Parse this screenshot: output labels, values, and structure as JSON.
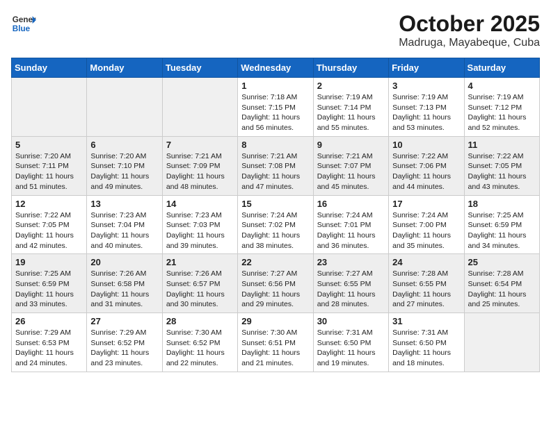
{
  "header": {
    "logo_general": "General",
    "logo_blue": "Blue",
    "month": "October 2025",
    "location": "Madruga, Mayabeque, Cuba"
  },
  "weekdays": [
    "Sunday",
    "Monday",
    "Tuesday",
    "Wednesday",
    "Thursday",
    "Friday",
    "Saturday"
  ],
  "weeks": [
    [
      {
        "day": "",
        "sunrise": "",
        "sunset": "",
        "daylight": ""
      },
      {
        "day": "",
        "sunrise": "",
        "sunset": "",
        "daylight": ""
      },
      {
        "day": "",
        "sunrise": "",
        "sunset": "",
        "daylight": ""
      },
      {
        "day": "1",
        "sunrise": "Sunrise: 7:18 AM",
        "sunset": "Sunset: 7:15 PM",
        "daylight": "Daylight: 11 hours and 56 minutes."
      },
      {
        "day": "2",
        "sunrise": "Sunrise: 7:19 AM",
        "sunset": "Sunset: 7:14 PM",
        "daylight": "Daylight: 11 hours and 55 minutes."
      },
      {
        "day": "3",
        "sunrise": "Sunrise: 7:19 AM",
        "sunset": "Sunset: 7:13 PM",
        "daylight": "Daylight: 11 hours and 53 minutes."
      },
      {
        "day": "4",
        "sunrise": "Sunrise: 7:19 AM",
        "sunset": "Sunset: 7:12 PM",
        "daylight": "Daylight: 11 hours and 52 minutes."
      }
    ],
    [
      {
        "day": "5",
        "sunrise": "Sunrise: 7:20 AM",
        "sunset": "Sunset: 7:11 PM",
        "daylight": "Daylight: 11 hours and 51 minutes."
      },
      {
        "day": "6",
        "sunrise": "Sunrise: 7:20 AM",
        "sunset": "Sunset: 7:10 PM",
        "daylight": "Daylight: 11 hours and 49 minutes."
      },
      {
        "day": "7",
        "sunrise": "Sunrise: 7:21 AM",
        "sunset": "Sunset: 7:09 PM",
        "daylight": "Daylight: 11 hours and 48 minutes."
      },
      {
        "day": "8",
        "sunrise": "Sunrise: 7:21 AM",
        "sunset": "Sunset: 7:08 PM",
        "daylight": "Daylight: 11 hours and 47 minutes."
      },
      {
        "day": "9",
        "sunrise": "Sunrise: 7:21 AM",
        "sunset": "Sunset: 7:07 PM",
        "daylight": "Daylight: 11 hours and 45 minutes."
      },
      {
        "day": "10",
        "sunrise": "Sunrise: 7:22 AM",
        "sunset": "Sunset: 7:06 PM",
        "daylight": "Daylight: 11 hours and 44 minutes."
      },
      {
        "day": "11",
        "sunrise": "Sunrise: 7:22 AM",
        "sunset": "Sunset: 7:05 PM",
        "daylight": "Daylight: 11 hours and 43 minutes."
      }
    ],
    [
      {
        "day": "12",
        "sunrise": "Sunrise: 7:22 AM",
        "sunset": "Sunset: 7:05 PM",
        "daylight": "Daylight: 11 hours and 42 minutes."
      },
      {
        "day": "13",
        "sunrise": "Sunrise: 7:23 AM",
        "sunset": "Sunset: 7:04 PM",
        "daylight": "Daylight: 11 hours and 40 minutes."
      },
      {
        "day": "14",
        "sunrise": "Sunrise: 7:23 AM",
        "sunset": "Sunset: 7:03 PM",
        "daylight": "Daylight: 11 hours and 39 minutes."
      },
      {
        "day": "15",
        "sunrise": "Sunrise: 7:24 AM",
        "sunset": "Sunset: 7:02 PM",
        "daylight": "Daylight: 11 hours and 38 minutes."
      },
      {
        "day": "16",
        "sunrise": "Sunrise: 7:24 AM",
        "sunset": "Sunset: 7:01 PM",
        "daylight": "Daylight: 11 hours and 36 minutes."
      },
      {
        "day": "17",
        "sunrise": "Sunrise: 7:24 AM",
        "sunset": "Sunset: 7:00 PM",
        "daylight": "Daylight: 11 hours and 35 minutes."
      },
      {
        "day": "18",
        "sunrise": "Sunrise: 7:25 AM",
        "sunset": "Sunset: 6:59 PM",
        "daylight": "Daylight: 11 hours and 34 minutes."
      }
    ],
    [
      {
        "day": "19",
        "sunrise": "Sunrise: 7:25 AM",
        "sunset": "Sunset: 6:59 PM",
        "daylight": "Daylight: 11 hours and 33 minutes."
      },
      {
        "day": "20",
        "sunrise": "Sunrise: 7:26 AM",
        "sunset": "Sunset: 6:58 PM",
        "daylight": "Daylight: 11 hours and 31 minutes."
      },
      {
        "day": "21",
        "sunrise": "Sunrise: 7:26 AM",
        "sunset": "Sunset: 6:57 PM",
        "daylight": "Daylight: 11 hours and 30 minutes."
      },
      {
        "day": "22",
        "sunrise": "Sunrise: 7:27 AM",
        "sunset": "Sunset: 6:56 PM",
        "daylight": "Daylight: 11 hours and 29 minutes."
      },
      {
        "day": "23",
        "sunrise": "Sunrise: 7:27 AM",
        "sunset": "Sunset: 6:55 PM",
        "daylight": "Daylight: 11 hours and 28 minutes."
      },
      {
        "day": "24",
        "sunrise": "Sunrise: 7:28 AM",
        "sunset": "Sunset: 6:55 PM",
        "daylight": "Daylight: 11 hours and 27 minutes."
      },
      {
        "day": "25",
        "sunrise": "Sunrise: 7:28 AM",
        "sunset": "Sunset: 6:54 PM",
        "daylight": "Daylight: 11 hours and 25 minutes."
      }
    ],
    [
      {
        "day": "26",
        "sunrise": "Sunrise: 7:29 AM",
        "sunset": "Sunset: 6:53 PM",
        "daylight": "Daylight: 11 hours and 24 minutes."
      },
      {
        "day": "27",
        "sunrise": "Sunrise: 7:29 AM",
        "sunset": "Sunset: 6:52 PM",
        "daylight": "Daylight: 11 hours and 23 minutes."
      },
      {
        "day": "28",
        "sunrise": "Sunrise: 7:30 AM",
        "sunset": "Sunset: 6:52 PM",
        "daylight": "Daylight: 11 hours and 22 minutes."
      },
      {
        "day": "29",
        "sunrise": "Sunrise: 7:30 AM",
        "sunset": "Sunset: 6:51 PM",
        "daylight": "Daylight: 11 hours and 21 minutes."
      },
      {
        "day": "30",
        "sunrise": "Sunrise: 7:31 AM",
        "sunset": "Sunset: 6:50 PM",
        "daylight": "Daylight: 11 hours and 19 minutes."
      },
      {
        "day": "31",
        "sunrise": "Sunrise: 7:31 AM",
        "sunset": "Sunset: 6:50 PM",
        "daylight": "Daylight: 11 hours and 18 minutes."
      },
      {
        "day": "",
        "sunrise": "",
        "sunset": "",
        "daylight": ""
      }
    ]
  ]
}
